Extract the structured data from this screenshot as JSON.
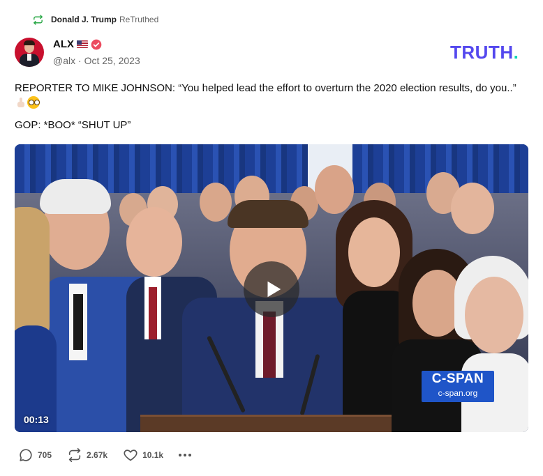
{
  "retruth": {
    "user": "Donald J. Trump",
    "label": "ReTruthed"
  },
  "author": {
    "name": "ALX",
    "handle": "@alx",
    "date": "Oct 25, 2023",
    "verified": true
  },
  "brand": {
    "logo_text": "TRUTH",
    "logo_dot": "."
  },
  "post": {
    "line1": "REPORTER TO MIKE JOHNSON: “You helped lead the effort to overturn the 2020 election results, do you..”",
    "line2": "GOP: *BOO* “SHUT UP”"
  },
  "video": {
    "duration": "00:13",
    "overlay_brand": "C-SPAN",
    "overlay_url": "c-span.org"
  },
  "actions": {
    "replies": "705",
    "retruths": "2.67k",
    "likes": "10.1k"
  },
  "colors": {
    "brand_purple": "#5448ee",
    "brand_teal": "#0fd6b6",
    "retruth_green": "#28a745",
    "verified_red": "#ec4b5f"
  }
}
